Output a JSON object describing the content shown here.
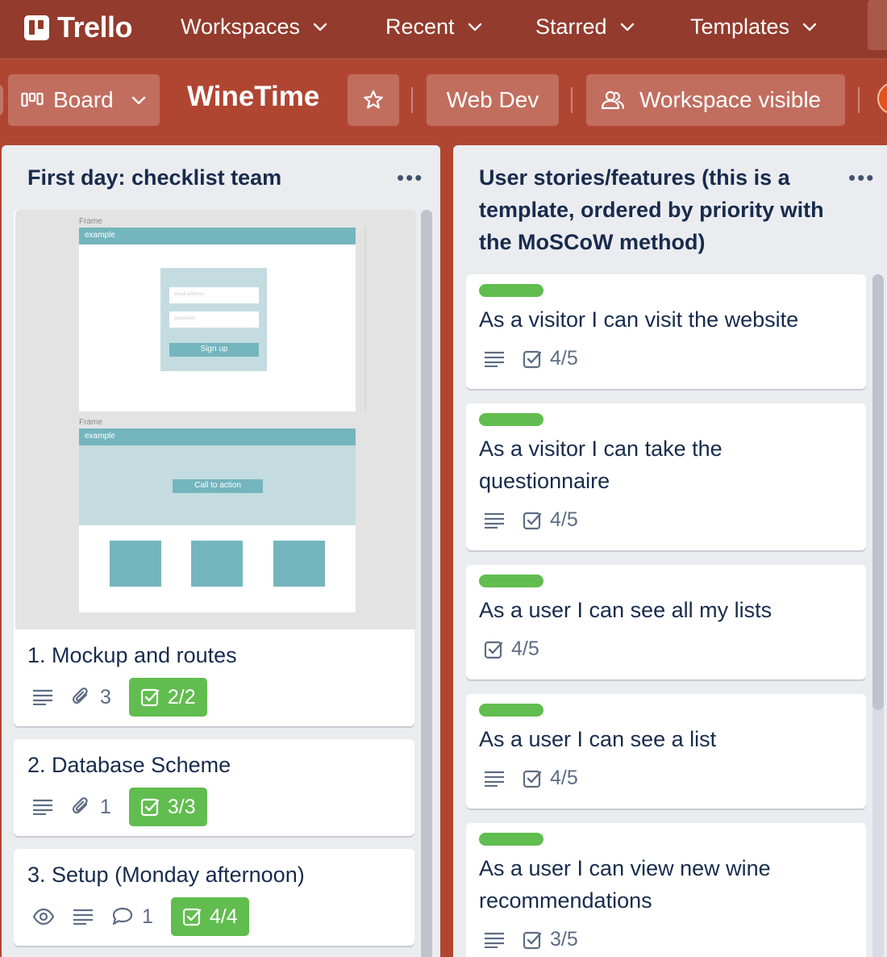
{
  "topnav": {
    "logo": "Trello",
    "items": [
      {
        "label": "Workspaces"
      },
      {
        "label": "Recent"
      },
      {
        "label": "Starred"
      },
      {
        "label": "Templates"
      }
    ]
  },
  "board": {
    "view_label": "Board",
    "title": "WineTime",
    "workspace": "Web Dev",
    "visibility": "Workspace visible"
  },
  "lists": [
    {
      "title": "First day: checklist team",
      "cover": {
        "frame_label_1": "Frame",
        "frame_label_2": "Frame",
        "bar_1": "example",
        "bar_2": "example",
        "email_placeholder": "email address",
        "password_placeholder": "password",
        "signup": "Sign up",
        "cta": "Call to action"
      },
      "cards": [
        {
          "title": "1. Mockup and routes",
          "attachments": "3",
          "checklist": "2/2"
        },
        {
          "title": "2. Database Scheme",
          "attachments": "1",
          "checklist": "3/3"
        },
        {
          "title": "3. Setup (Monday afternoon)",
          "comments": "1",
          "checklist": "4/4"
        }
      ]
    },
    {
      "title": "User stories/features (this is a template, ordered by priority with the MoSCoW method)",
      "cards": [
        {
          "title": "As a visitor I can visit the website",
          "label_color": "#61bd4f",
          "checklist": "4/5"
        },
        {
          "title": "As a visitor I can take the questionnaire",
          "label_color": "#61bd4f",
          "checklist": "4/5"
        },
        {
          "title": "As a user I can see all my lists",
          "label_color": "#61bd4f",
          "checklist": "4/5"
        },
        {
          "title": "As a user I can see a list",
          "label_color": "#61bd4f",
          "checklist": "4/5"
        },
        {
          "title": "As a user I can view new wine recommendations",
          "label_color": "#61bd4f",
          "checklist": "3/5"
        }
      ]
    }
  ]
}
